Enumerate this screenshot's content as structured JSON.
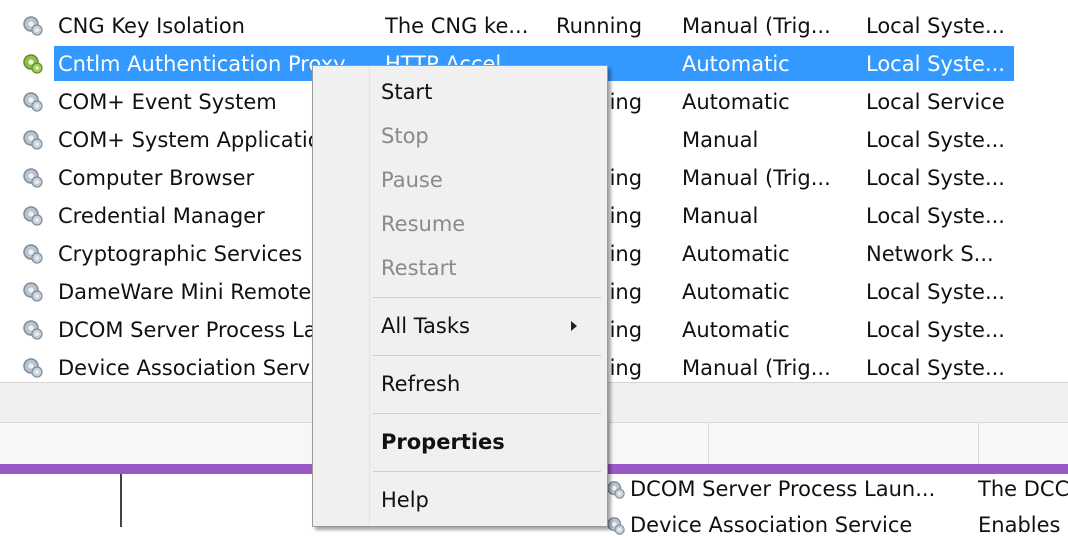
{
  "services": [
    {
      "name": "CNG Key Isolation",
      "description": "The CNG ke...",
      "status": "Running",
      "startup": "Manual (Trig...",
      "logon": "Local Syste...",
      "selected": false
    },
    {
      "name": "Cntlm Authentication Proxy",
      "description": "HTTP Accel...",
      "status": "",
      "startup": "Automatic",
      "logon": "Local Syste...",
      "selected": true
    },
    {
      "name": "COM+ Event System",
      "description": "",
      "status": "Running",
      "startup": "Automatic",
      "logon": "Local Service",
      "selected": false
    },
    {
      "name": "COM+ System Application",
      "description": "",
      "status": "",
      "startup": "Manual",
      "logon": "Local Syste...",
      "selected": false
    },
    {
      "name": "Computer Browser",
      "description": "",
      "status": "Running",
      "startup": "Manual (Trig...",
      "logon": "Local Syste...",
      "selected": false
    },
    {
      "name": "Credential Manager",
      "description": "",
      "status": "Running",
      "startup": "Manual",
      "logon": "Local Syste...",
      "selected": false
    },
    {
      "name": "Cryptographic Services",
      "description": "",
      "status": "Running",
      "startup": "Automatic",
      "logon": "Network S...",
      "selected": false
    },
    {
      "name": "DameWare Mini Remote Control",
      "description": "",
      "status": "Running",
      "startup": "Automatic",
      "logon": "Local Syste...",
      "selected": false
    },
    {
      "name": "DCOM Server Process Launcher",
      "description": "",
      "status": "Running",
      "startup": "Automatic",
      "logon": "Local Syste...",
      "selected": false
    },
    {
      "name": "Device Association Service",
      "description": "",
      "status": "Running",
      "startup": "Manual (Trig...",
      "logon": "Local Syste...",
      "selected": false
    }
  ],
  "context_menu": {
    "start": "Start",
    "stop": "Stop",
    "pause": "Pause",
    "resume": "Resume",
    "restart": "Restart",
    "all_tasks": "All Tasks",
    "refresh": "Refresh",
    "properties": "Properties",
    "help": "Help"
  },
  "lower_pane": {
    "item1_name": "DCOM Server Process Laun...",
    "item1_desc": "The DCC",
    "item2_name": "Device Association Service",
    "item2_desc": "Enables"
  },
  "colors": {
    "selection": "#3399ff",
    "accent_bar": "#9b59c8",
    "menu_bg": "#f0f0f0"
  },
  "icons": {
    "service": "gear-icon",
    "submenu": "submenu-arrow-icon"
  }
}
